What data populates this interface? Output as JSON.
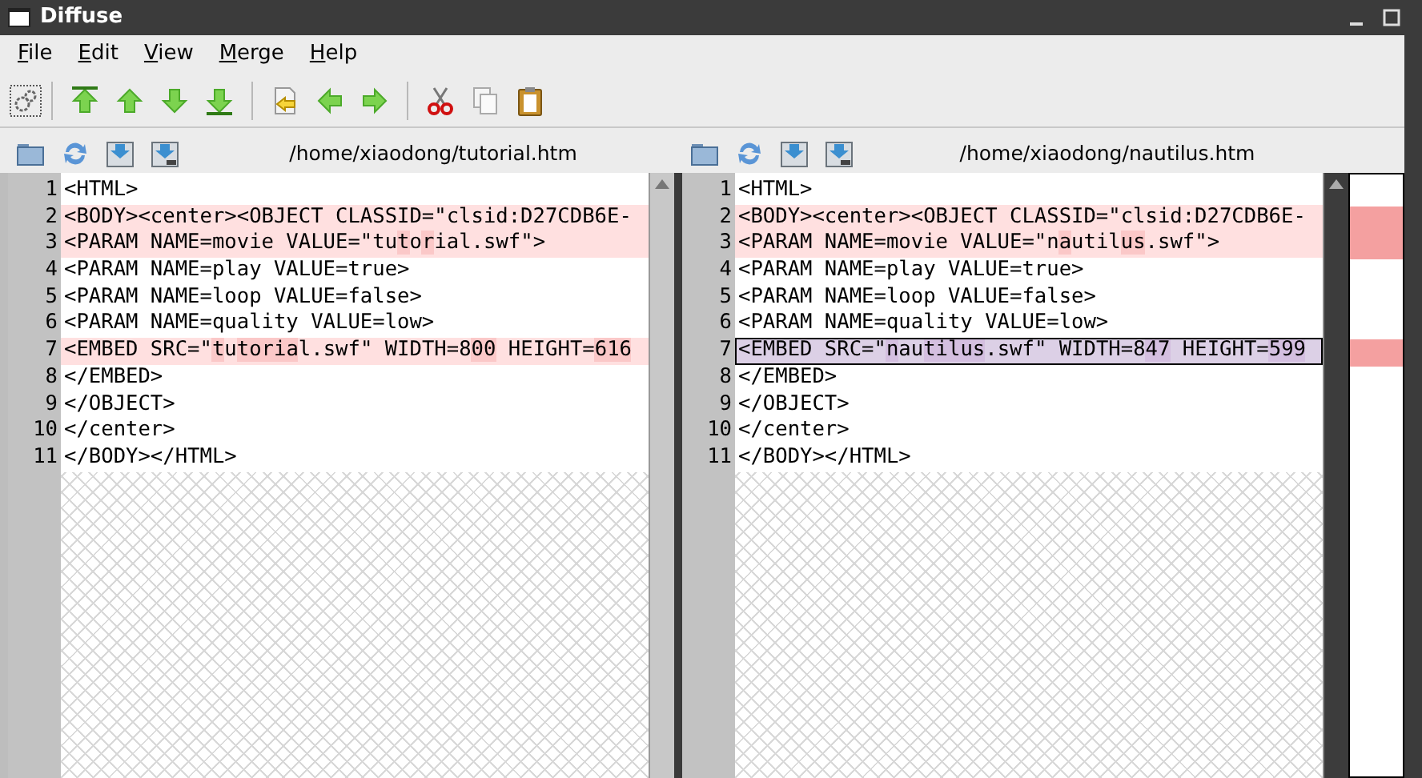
{
  "window": {
    "title": "Diffuse"
  },
  "menu": [
    {
      "label": "File"
    },
    {
      "label": "Edit"
    },
    {
      "label": "View"
    },
    {
      "label": "Merge"
    },
    {
      "label": "Help"
    }
  ],
  "panes": [
    {
      "path": "/home/xiaodong/tutorial.htm",
      "lines": [
        {
          "number": "1",
          "changed": false,
          "selected": false,
          "segments": [
            {
              "text": "<HTML>",
              "changed": false
            }
          ]
        },
        {
          "number": "2",
          "changed": true,
          "selected": false,
          "segments": [
            {
              "text": "<BODY><center><OBJECT CLASSID=\"clsid:D27CDB6E-",
              "changed": false
            }
          ]
        },
        {
          "number": "3",
          "changed": true,
          "selected": false,
          "segments": [
            {
              "text": "<PARAM NAME=movie VALUE=\"tu",
              "changed": false
            },
            {
              "text": "t",
              "changed": true
            },
            {
              "text": "o",
              "changed": false
            },
            {
              "text": "r",
              "changed": true
            },
            {
              "text": "ial.swf\">",
              "changed": false
            }
          ]
        },
        {
          "number": "4",
          "changed": false,
          "selected": false,
          "segments": [
            {
              "text": "<PARAM NAME=play VALUE=true>",
              "changed": false
            }
          ]
        },
        {
          "number": "5",
          "changed": false,
          "selected": false,
          "segments": [
            {
              "text": "<PARAM NAME=loop VALUE=false>",
              "changed": false
            }
          ]
        },
        {
          "number": "6",
          "changed": false,
          "selected": false,
          "segments": [
            {
              "text": "<PARAM NAME=quality VALUE=low>",
              "changed": false
            }
          ]
        },
        {
          "number": "7",
          "changed": true,
          "selected": false,
          "segments": [
            {
              "text": "<EMBED SRC=\"",
              "changed": false
            },
            {
              "text": "t",
              "changed": true
            },
            {
              "text": "u",
              "changed": false
            },
            {
              "text": "toria",
              "changed": true
            },
            {
              "text": "l.swf\" WIDTH=8",
              "changed": false
            },
            {
              "text": "00",
              "changed": true
            },
            {
              "text": " HEIGHT=",
              "changed": false
            },
            {
              "text": "616",
              "changed": true
            }
          ]
        },
        {
          "number": "8",
          "changed": false,
          "selected": false,
          "segments": [
            {
              "text": "</EMBED>",
              "changed": false
            }
          ]
        },
        {
          "number": "9",
          "changed": false,
          "selected": false,
          "segments": [
            {
              "text": "</OBJECT>",
              "changed": false
            }
          ]
        },
        {
          "number": "10",
          "changed": false,
          "selected": false,
          "segments": [
            {
              "text": "</center>",
              "changed": false
            }
          ]
        },
        {
          "number": "11",
          "changed": false,
          "selected": false,
          "segments": [
            {
              "text": "</BODY></HTML>",
              "changed": false
            }
          ]
        }
      ]
    },
    {
      "path": "/home/xiaodong/nautilus.htm",
      "lines": [
        {
          "number": "1",
          "changed": false,
          "selected": false,
          "segments": [
            {
              "text": "<HTML>",
              "changed": false
            }
          ]
        },
        {
          "number": "2",
          "changed": true,
          "selected": false,
          "segments": [
            {
              "text": "<BODY><center><OBJECT CLASSID=\"clsid:D27CDB6E-",
              "changed": false
            }
          ]
        },
        {
          "number": "3",
          "changed": true,
          "selected": false,
          "segments": [
            {
              "text": "<PARAM NAME=movie VALUE=\"n",
              "changed": false
            },
            {
              "text": "a",
              "changed": true
            },
            {
              "text": "util",
              "changed": false
            },
            {
              "text": "us",
              "changed": true
            },
            {
              "text": ".swf\">",
              "changed": false
            }
          ]
        },
        {
          "number": "4",
          "changed": false,
          "selected": false,
          "segments": [
            {
              "text": "<PARAM NAME=play VALUE=true>",
              "changed": false
            }
          ]
        },
        {
          "number": "5",
          "changed": false,
          "selected": false,
          "segments": [
            {
              "text": "<PARAM NAME=loop VALUE=false>",
              "changed": false
            }
          ]
        },
        {
          "number": "6",
          "changed": false,
          "selected": false,
          "segments": [
            {
              "text": "<PARAM NAME=quality VALUE=low>",
              "changed": false
            }
          ]
        },
        {
          "number": "7",
          "changed": true,
          "selected": true,
          "segments": [
            {
              "text": "<EMBED SRC=\"",
              "changed": false
            },
            {
              "text": "n",
              "changed": true
            },
            {
              "text": "au",
              "changed": false
            },
            {
              "text": "tilus",
              "changed": true
            },
            {
              "text": ".swf\" WIDTH=8",
              "changed": false
            },
            {
              "text": "47",
              "changed": true
            },
            {
              "text": " HEIGHT=",
              "changed": false
            },
            {
              "text": "599",
              "changed": true
            }
          ]
        },
        {
          "number": "8",
          "changed": false,
          "selected": false,
          "segments": [
            {
              "text": "</EMBED>",
              "changed": false
            }
          ]
        },
        {
          "number": "9",
          "changed": false,
          "selected": false,
          "segments": [
            {
              "text": "</OBJECT>",
              "changed": false
            }
          ]
        },
        {
          "number": "10",
          "changed": false,
          "selected": false,
          "segments": [
            {
              "text": "</center>",
              "changed": false
            }
          ]
        },
        {
          "number": "11",
          "changed": false,
          "selected": false,
          "segments": [
            {
              "text": "</BODY></HTML>",
              "changed": false
            }
          ]
        }
      ]
    }
  ]
}
